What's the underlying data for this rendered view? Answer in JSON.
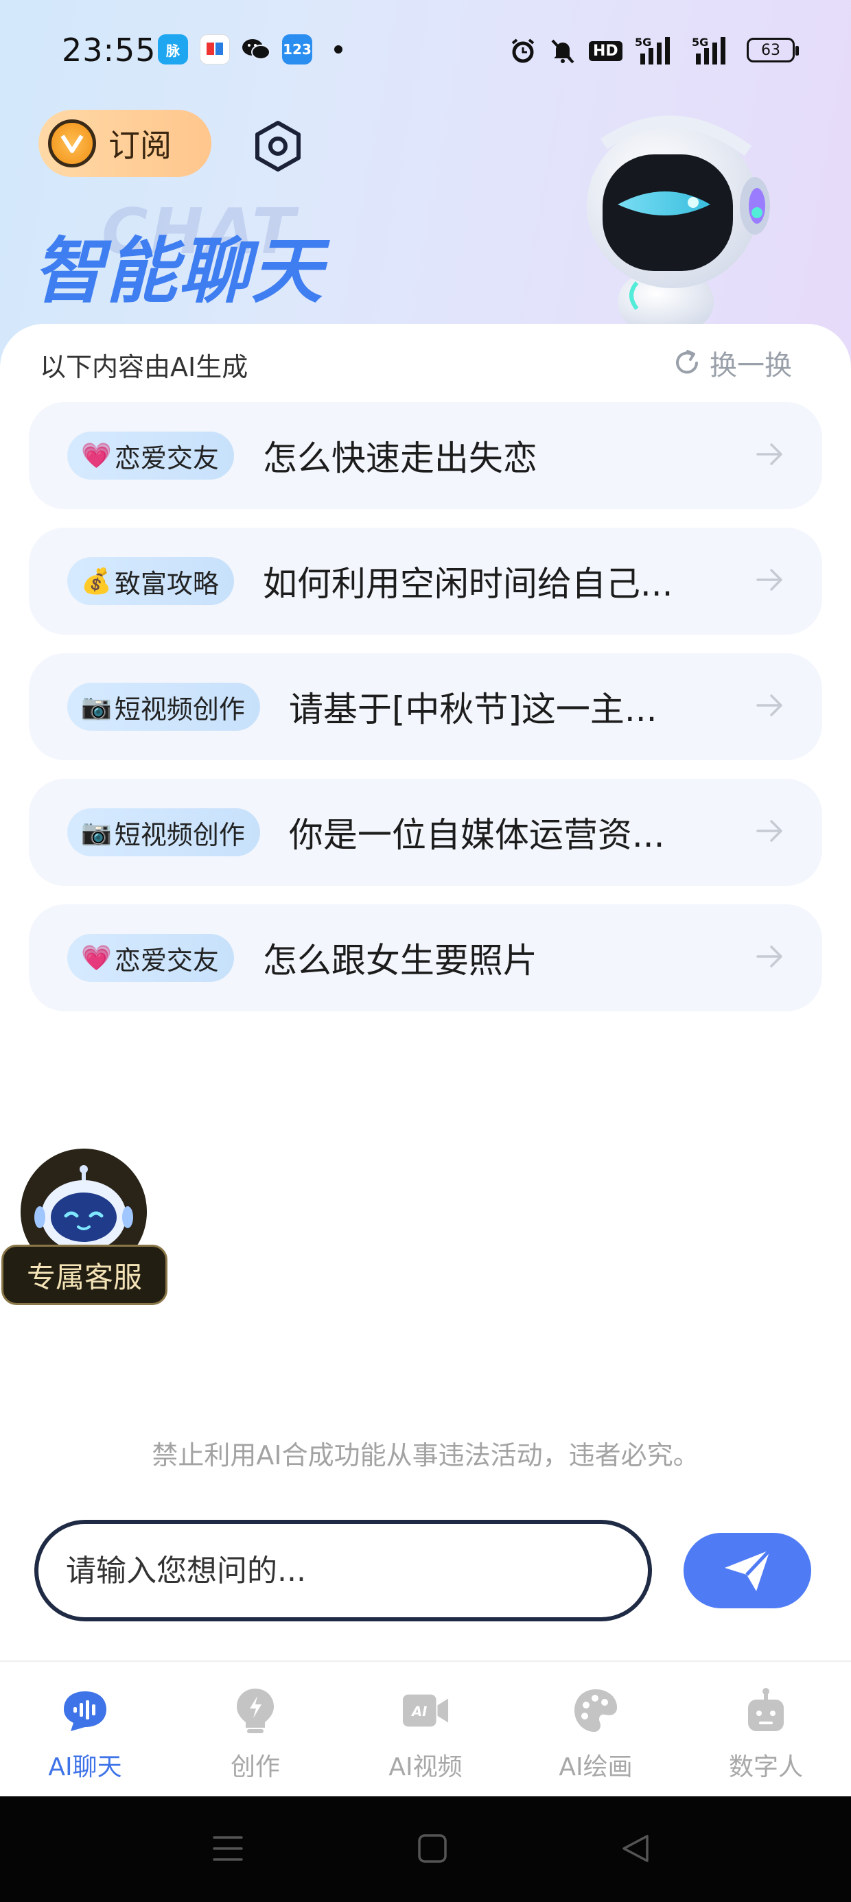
{
  "status_bar": {
    "time": "23:55",
    "battery": "63",
    "hd_label": "HD",
    "network_1": "5G",
    "network_2": "5G",
    "icons": [
      "alarm-icon",
      "mute-icon",
      "hd-icon",
      "signal-icon",
      "signal-icon",
      "battery-icon"
    ]
  },
  "header": {
    "subscribe_label": "订阅",
    "title": "智能聊天",
    "title_ghost": "CHAT"
  },
  "suggestions": {
    "note": "以下内容由AI生成",
    "refresh_label": "换一换",
    "items": [
      {
        "emoji": "💗",
        "tag": "恋爱交友",
        "text": "怎么快速走出失恋"
      },
      {
        "emoji": "💰",
        "tag": "致富攻略",
        "text": "如何利用空闲时间给自己..."
      },
      {
        "emoji": "📷",
        "tag": "短视频创作",
        "text": "请基于[中秋节]这一主..."
      },
      {
        "emoji": "📷",
        "tag": "短视频创作",
        "text": "你是一位自媒体运营资..."
      },
      {
        "emoji": "💗",
        "tag": "恋爱交友",
        "text": "怎么跟女生要照片"
      }
    ]
  },
  "customer_service": {
    "label": "专属客服"
  },
  "disclaimer": "禁止利用AI合成功能从事违法活动，违者必究。",
  "chat_input": {
    "placeholder": "请输入您想问的..."
  },
  "bottom_nav": {
    "items": [
      {
        "label": "AI聊天",
        "icon": "chat-voice-icon",
        "active": true
      },
      {
        "label": "创作",
        "icon": "bulb-icon",
        "active": false
      },
      {
        "label": "AI视频",
        "icon": "video-camera-icon",
        "active": false
      },
      {
        "label": "AI绘画",
        "icon": "palette-icon",
        "active": false
      },
      {
        "label": "数字人",
        "icon": "robot-icon",
        "active": false
      }
    ]
  },
  "colors": {
    "accent": "#3f73e8",
    "send_button": "#4f7bf5",
    "card_bg": "#f3f6fc",
    "tag_bg": "#d2e7fd"
  }
}
